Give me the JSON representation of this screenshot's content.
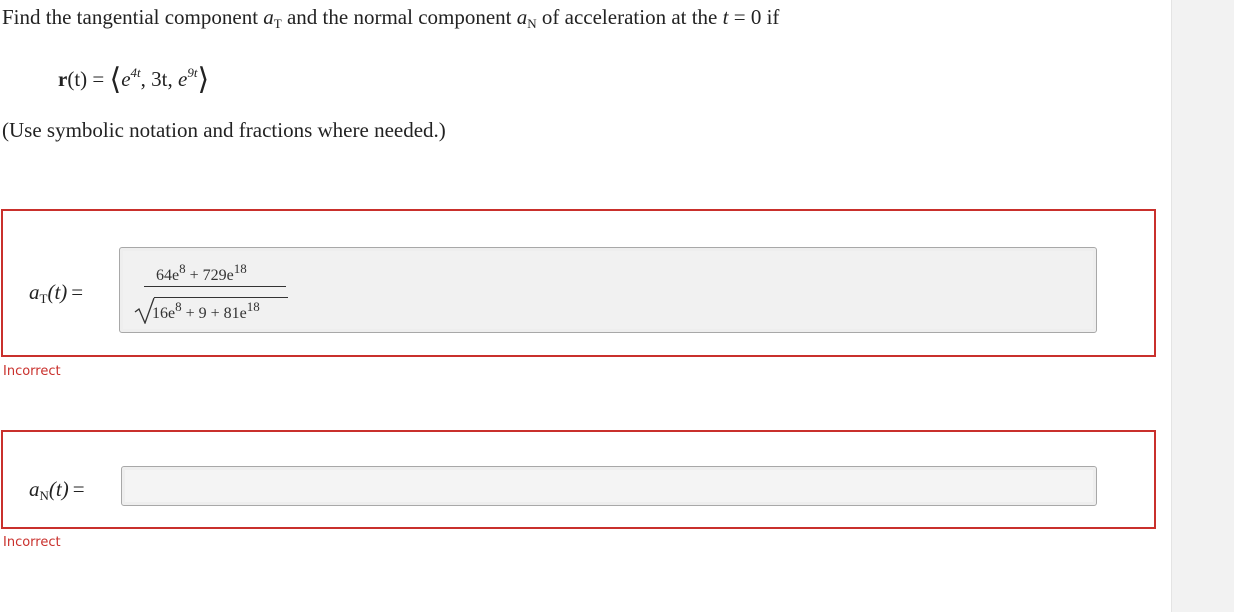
{
  "question": {
    "part1": "Find the tangential component ",
    "aT_letter": "a",
    "aT_sub": "T",
    "part2": " and the normal component ",
    "aN_letter": "a",
    "aN_sub": "N",
    "part3": " of acceleration at the ",
    "t_var": "t",
    "part4": " = 0 if",
    "formula": {
      "r": "r",
      "lhs_rest": "(t) = ",
      "open": "⟨",
      "e1": "e",
      "e1_exp": "4t",
      "mid": ", 3t, ",
      "e2": "e",
      "e2_exp": "9t",
      "close": "⟩"
    },
    "hint": "(Use symbolic notation and fractions where needed.)"
  },
  "answers": [
    {
      "label_letter": "a",
      "label_sub": "T",
      "label_tail": "(t)",
      "label_eq": "=",
      "value": {
        "numerator_a": "64e",
        "numerator_a_exp": "8",
        "numerator_b": " + 729e",
        "numerator_b_exp": "18",
        "denominator_a": "16e",
        "denominator_a_exp": "8",
        "denominator_b": " + 9 + 81e",
        "denominator_b_exp": "18"
      },
      "status": "Incorrect"
    },
    {
      "label_letter": "a",
      "label_sub": "N",
      "label_tail": "(t)",
      "label_eq": "=",
      "value": "",
      "status": "Incorrect"
    }
  ],
  "colors": {
    "error": "#c9302c",
    "side_panel": "#f2f2f2"
  }
}
